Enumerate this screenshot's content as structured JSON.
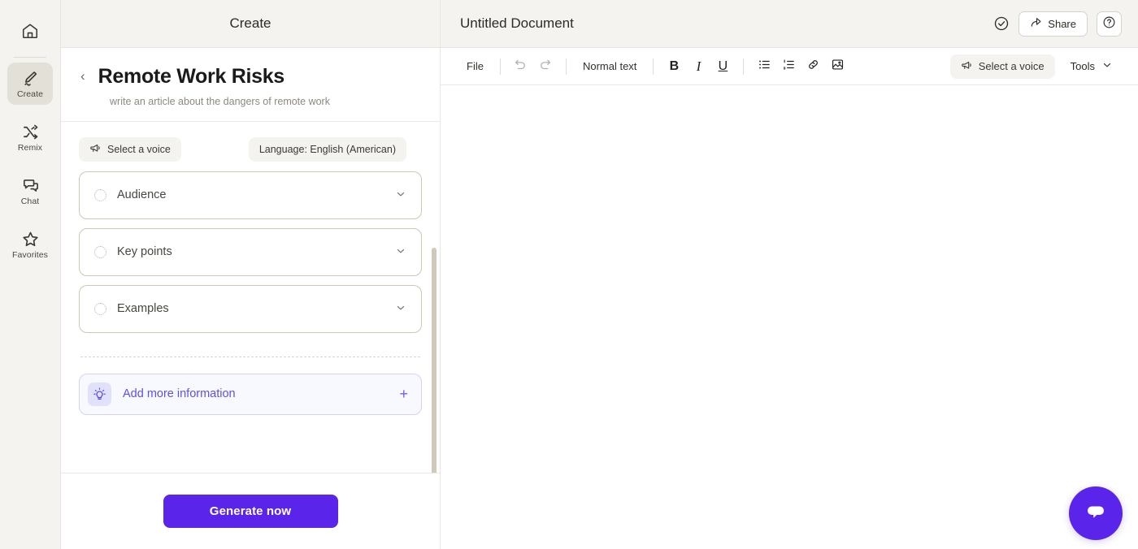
{
  "rail": {
    "home_icon": "home-icon",
    "items": [
      {
        "label": "Create",
        "icon": "pen-icon",
        "active": true
      },
      {
        "label": "Remix",
        "icon": "shuffle-icon",
        "active": false
      },
      {
        "label": "Chat",
        "icon": "chat-icon",
        "active": false
      },
      {
        "label": "Favorites",
        "icon": "star-icon",
        "active": false
      }
    ]
  },
  "panel": {
    "header_title": "Create",
    "back_chevron": "‹",
    "title": "Remote Work Risks",
    "subtitle": "write an article about the dangers of remote work",
    "voice_chip": "Select a voice",
    "language_chip": "Language: English (American)",
    "sections": [
      {
        "label": "Audience",
        "chevron": "⌄"
      },
      {
        "label": "Key points",
        "chevron": "⌄"
      },
      {
        "label": "Examples",
        "chevron": "⌄"
      }
    ],
    "add_more_label": "Add more information",
    "add_more_plus": "+",
    "generate_label": "Generate now"
  },
  "document": {
    "name": "Untitled Document",
    "saved_icon": "check-circle-icon",
    "share_label": "Share",
    "share_icon": "share-arrow-icon",
    "help_icon": "question-circle-icon"
  },
  "toolbar": {
    "file_label": "File",
    "undo_icon": "undo-icon",
    "redo_icon": "redo-icon",
    "style_label": "Normal text",
    "bold_label": "B",
    "italic_label": "I",
    "underline_label": "U",
    "bullet_list_icon": "bulleted-list-icon",
    "numbered_list_icon": "numbered-list-icon",
    "link_icon": "link-icon",
    "image_icon": "image-icon",
    "voice_label": "Select a voice",
    "voice_icon": "megaphone-icon",
    "tools_label": "Tools",
    "tools_chevron": "⌄"
  },
  "chat_fab": {
    "icon": "chat-bubble-icon"
  },
  "colors": {
    "accent": "#5b24ea",
    "rail_bg": "#f4f3f0",
    "card_border": "#cfc7b5",
    "addmore_text": "#5b51e8",
    "addmore_bg": "#f8f8ff"
  }
}
